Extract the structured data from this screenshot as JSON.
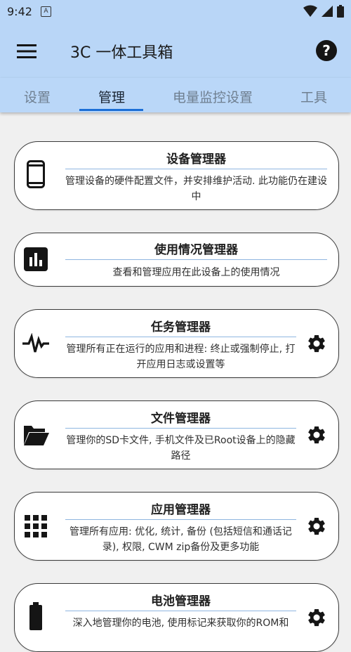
{
  "status_bar": {
    "time": "9:42",
    "notification_icon": "a-icon",
    "icons": [
      "wifi-icon",
      "signal-icon",
      "battery-icon"
    ]
  },
  "app_bar": {
    "title": "3C 一体工具箱",
    "menu_icon": "menu-icon",
    "help_icon": "help-icon",
    "help_glyph": "?"
  },
  "tabs": [
    {
      "label": "设置",
      "active": false
    },
    {
      "label": "管理",
      "active": true
    },
    {
      "label": "电量监控设置",
      "active": false
    },
    {
      "label": "工具",
      "active": false
    }
  ],
  "cards": [
    {
      "title": "设备管理器",
      "description": "管理设备的硬件配置文件，并安排维护活动. 此功能仍在建设中",
      "icon": "phone-icon",
      "has_settings": false
    },
    {
      "title": "使用情况管理器",
      "description": "查看和管理应用在此设备上的使用情况",
      "icon": "bar-chart-icon",
      "has_settings": false
    },
    {
      "title": "任务管理器",
      "description": "管理所有正在运行的应用和进程: 终止或强制停止, 打开应用日志或设置等",
      "icon": "pulse-icon",
      "has_settings": true
    },
    {
      "title": "文件管理器",
      "description": "管理你的SD卡文件, 手机文件及已Root设备上的隐藏路径",
      "icon": "folder-icon",
      "has_settings": true
    },
    {
      "title": "应用管理器",
      "description": "管理所有应用: 优化, 统计, 备份 (包括短信和通话记录), 权限, CWM zip备份及更多功能",
      "icon": "grid-icon",
      "has_settings": true
    },
    {
      "title": "电池管理器",
      "description": "深入地管理你的电池, 使用标记来获取你的ROM和",
      "icon": "battery-icon",
      "has_settings": true
    }
  ],
  "colors": {
    "app_bar": "#b9d6f7",
    "tab_indicator": "#1b6ed6",
    "divider": "#8fb6e0",
    "background": "#f0f0f0"
  }
}
